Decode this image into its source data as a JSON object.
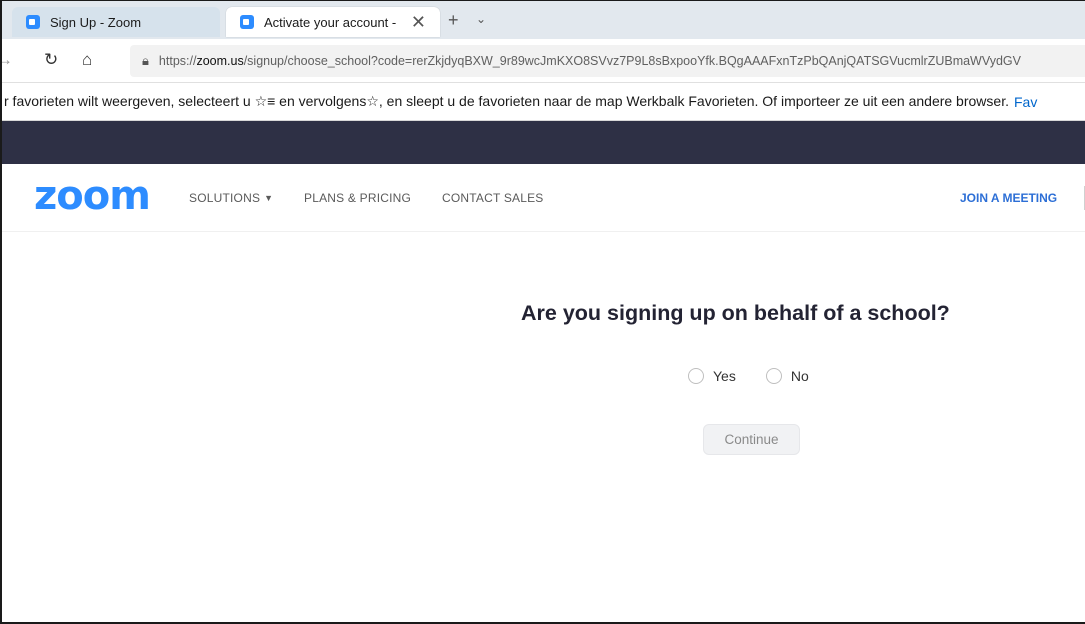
{
  "browser": {
    "tabs": [
      {
        "title": "Sign Up - Zoom",
        "active": false
      },
      {
        "title": "Activate your account -",
        "active": true
      }
    ],
    "tab_close_glyph": "✕",
    "new_tab_glyph": "+",
    "tab_menu_glyph": "⌄",
    "url_prefix": "https://",
    "url_host": "zoom.us",
    "url_rest": "/signup/choose_school?code=rerZkjdyqBXW_9r89wcJmKXO8SVvz7P9L8sBxpooYfk.BQgAAAFxnTzPbQAnjQATSGVucmlrZUBmaWVydGV",
    "icons": [
      "back-icon",
      "refresh-icon",
      "home-icon",
      "lock-icon"
    ]
  },
  "favorites_bar": {
    "text": "r favorieten wilt weergeven, selecteert u ☆≡ en vervolgens☆, en sleept u de favorieten naar de map Werkbalk Favorieten. Of importeer ze uit een andere browser.",
    "link": "Fav"
  },
  "zoom_header": {
    "logo": "zoom",
    "nav": {
      "solutions": "SOLUTIONS",
      "plans": "PLANS & PRICING",
      "contact": "CONTACT SALES"
    },
    "join": "JOIN A MEETING"
  },
  "main": {
    "question": "Are you signing up on behalf of a school?",
    "options": {
      "yes": "Yes",
      "no": "No"
    },
    "continue_label": "Continue"
  },
  "colors": {
    "zoom_blue": "#2d8cff",
    "dark_band": "#2e3045",
    "tabstrip": "#e2e8ee"
  }
}
